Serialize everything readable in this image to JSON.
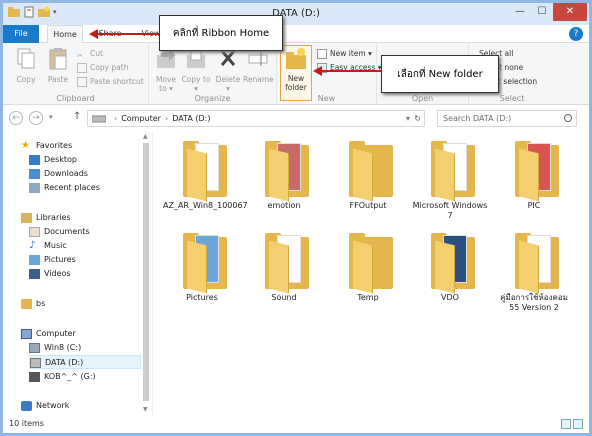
{
  "window": {
    "title": "DATA (D:)",
    "minimize": "—",
    "maximize": "☐",
    "close": "✕"
  },
  "tabs": {
    "file": "File",
    "home": "Home",
    "share": "Share",
    "view": "View",
    "toggle": "?"
  },
  "ribbon": {
    "clipboard": {
      "label": "Clipboard",
      "copy": "Copy",
      "paste": "Paste",
      "cut": "Cut",
      "copy_path": "Copy path",
      "paste_shortcut": "Paste shortcut"
    },
    "organize": {
      "label": "Organize",
      "move_to": "Move to ▾",
      "copy_to": "Copy to ▾",
      "delete": "Delete ▾",
      "rename": "Rename"
    },
    "new": {
      "label": "New",
      "new_folder": "New folder",
      "new_item": "New item ▾",
      "easy_access": "Easy access ▾"
    },
    "open": {
      "label": "Open"
    },
    "select": {
      "label": "Select",
      "select_all": "Select all",
      "select_none": "Select none",
      "invert_selection": "Invert selection"
    }
  },
  "addressbar": {
    "segments": [
      "Computer",
      "DATA (D:)"
    ],
    "search_placeholder": "Search DATA (D:)"
  },
  "nav": {
    "favorites": "Favorites",
    "fav_items": [
      "Desktop",
      "Downloads",
      "Recent places"
    ],
    "libraries": "Libraries",
    "lib_items": [
      "Documents",
      "Music",
      "Pictures",
      "Videos"
    ],
    "bs": "bs",
    "computer": "Computer",
    "comp_items": [
      "Win8 (C:)",
      "DATA (D:)",
      "KOB^_^ (G:)"
    ],
    "network": "Network"
  },
  "files": [
    {
      "name": "AZ_AR_Win8_100067",
      "line2": ""
    },
    {
      "name": "emotion",
      "line2": ""
    },
    {
      "name": "FFOutput",
      "line2": ""
    },
    {
      "name": "Microsoft Windows 7",
      "line2": ""
    },
    {
      "name": "PIC",
      "line2": ""
    },
    {
      "name": "Pictures",
      "line2": ""
    },
    {
      "name": "Sound",
      "line2": ""
    },
    {
      "name": "Temp",
      "line2": ""
    },
    {
      "name": "VDO",
      "line2": ""
    },
    {
      "name": "คู่มือการใช้ห้องคอม 55 Version 2",
      "line2": ""
    }
  ],
  "status": {
    "count": "10 items"
  },
  "callouts": {
    "ribbon_home": "คลิกที่ Ribbon Home",
    "new_folder": "เลือกที่ New folder"
  },
  "colors": {
    "accent": "#1979ca",
    "folder": "#e5b64c",
    "arrow": "#c41b1b",
    "highlight": "#e8a33a"
  }
}
